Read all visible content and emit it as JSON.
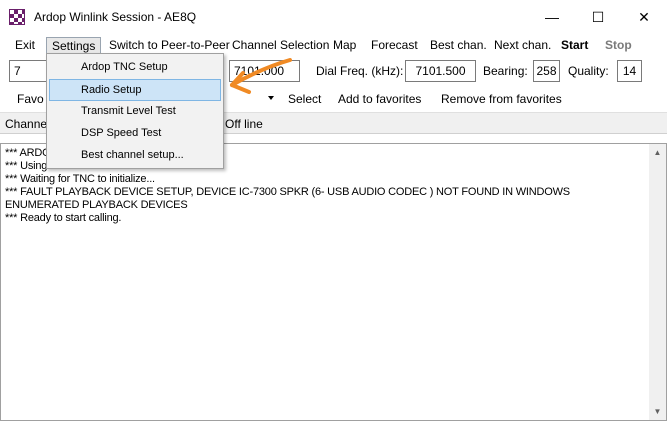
{
  "window": {
    "title": "Ardop Winlink Session - AE8Q",
    "minimize_glyph": "—",
    "maximize_glyph": "☐",
    "close_glyph": "✕"
  },
  "menu": {
    "items": [
      {
        "label": "Exit"
      },
      {
        "label": "Settings"
      },
      {
        "label": "Switch to Peer-to-Peer"
      },
      {
        "label": "Channel Selection"
      },
      {
        "label": "Map"
      },
      {
        "label": "Forecast"
      },
      {
        "label": "Best chan."
      },
      {
        "label": "Next chan."
      },
      {
        "label": "Start"
      },
      {
        "label": "Stop"
      }
    ]
  },
  "settings_menu": {
    "items": [
      {
        "label": "Ardop TNC Setup"
      },
      {
        "label": "Radio Setup"
      },
      {
        "label": "Transmit Level Test"
      },
      {
        "label": "DSP Speed Test"
      },
      {
        "label": "Best channel setup..."
      }
    ],
    "highlighted": "Radio Setup"
  },
  "controls": {
    "station_partial": "7",
    "center_freq_partial": "7101.000",
    "dial_freq_label": "Dial Freq. (kHz):",
    "dial_freq_value": "7101.500",
    "bearing_label": "Bearing:",
    "bearing_value": "258",
    "quality_label": "Quality:",
    "quality_value": "14",
    "favorites_partial": "Favo",
    "select_label": "Select",
    "add_favorites_label": "Add to favorites",
    "remove_favorites_label": "Remove from favorites"
  },
  "status": {
    "channel_partial": "Channe",
    "state_text": "Off line"
  },
  "log": {
    "lines": [
      "*** ARDO",
      "*** Using",
      "*** Waiting for TNC to initialize...",
      "*** FAULT PLAYBACK DEVICE SETUP, DEVICE IC-7300 SPKR (6- USB AUDIO CODEC ) NOT FOUND IN WINDOWS",
      "ENUMERATED PLAYBACK DEVICES",
      "*** Ready to start calling."
    ]
  },
  "icons": {
    "app": "checkerboard-icon",
    "dropdown": "chevron-down-icon",
    "scroll_up": "scroll-up-arrow-icon",
    "scroll_down": "scroll-down-arrow-icon",
    "annotation": "orange-arrow-annotation"
  },
  "colors": {
    "highlight_bg": "#cde4f7",
    "annotation": "#f08a24",
    "app_icon": "#6a1f6a"
  }
}
